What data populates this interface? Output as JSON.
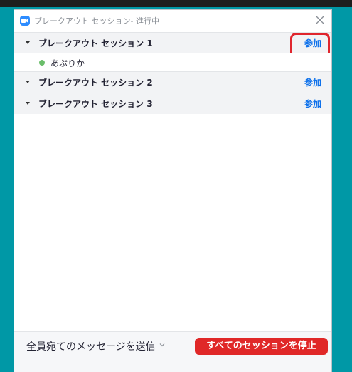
{
  "window": {
    "title": "ブレークアウト セッション- 進行中"
  },
  "sessions": [
    {
      "name": "ブレークアウト セッション 1",
      "join_label": "参加",
      "participants": [
        "あぷりか"
      ]
    },
    {
      "name": "ブレークアウト セッション 2",
      "join_label": "参加",
      "participants": []
    },
    {
      "name": "ブレークアウト セッション 3",
      "join_label": "参加",
      "participants": []
    }
  ],
  "footer": {
    "broadcast_label": "全員宛てのメッセージを送信",
    "stop_all_label": "すべてのセッションを停止"
  },
  "colors": {
    "desktop": "#0098A6",
    "accent": "#0E71EB",
    "danger": "#E02828",
    "annotation": "#E0262E",
    "online": "#6BBE6B"
  }
}
